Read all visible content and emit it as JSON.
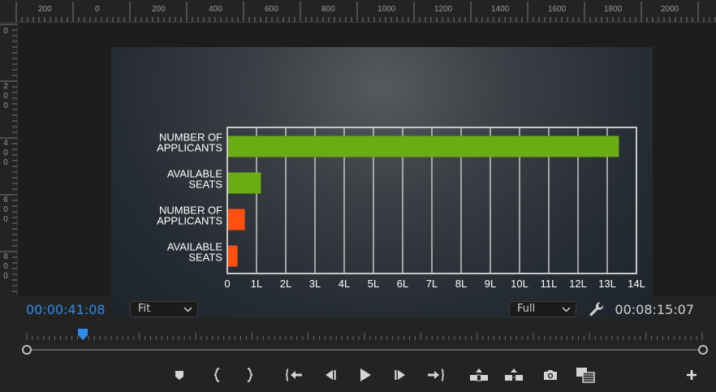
{
  "ruler": {
    "h_labels": [
      "200",
      "0",
      "200",
      "400",
      "600",
      "800",
      "1000",
      "1200",
      "1400",
      "1600",
      "1800",
      "2000"
    ],
    "v_labels": [
      "0",
      "2\n0\n0",
      "4\n0\n0",
      "6\n0\n0",
      "8\n0\n0"
    ]
  },
  "monitor": {
    "current_timecode": "00:00:41:08",
    "duration_timecode": "00:08:15:07",
    "zoom": {
      "selected": "Fit"
    },
    "resolution": {
      "selected": "Full"
    },
    "playhead_fraction": 0.083
  },
  "transport": {
    "buttons": [
      "add-marker",
      "mark-in",
      "mark-out",
      "go-to-in",
      "step-back",
      "play",
      "step-forward",
      "go-to-out",
      "lift",
      "extract",
      "export-frame",
      "comparison-view",
      "add-button"
    ]
  },
  "colors": {
    "accent": "#2d8ceb",
    "green_bar": "#6aac14",
    "orange_bar": "#ff5010"
  },
  "chart_data": {
    "type": "bar",
    "orientation": "horizontal",
    "categories": [
      [
        "NUMBER OF",
        "APPLICANTS"
      ],
      [
        "AVAILABLE",
        "SEATS"
      ],
      [
        "NUMBER OF",
        "APPLICANTS"
      ],
      [
        "AVAILABLE",
        "SEATS"
      ]
    ],
    "values": [
      13.4,
      1.15,
      0.6,
      0.35
    ],
    "bar_colors": [
      "#6aac14",
      "#6aac14",
      "#ff5010",
      "#ff5010"
    ],
    "xticks": [
      "0",
      "1L",
      "2L",
      "3L",
      "4L",
      "5L",
      "6L",
      "7L",
      "8L",
      "9L",
      "10L",
      "11L",
      "12L",
      "13L",
      "14L"
    ],
    "xlim": [
      0,
      14
    ],
    "grid": true
  }
}
